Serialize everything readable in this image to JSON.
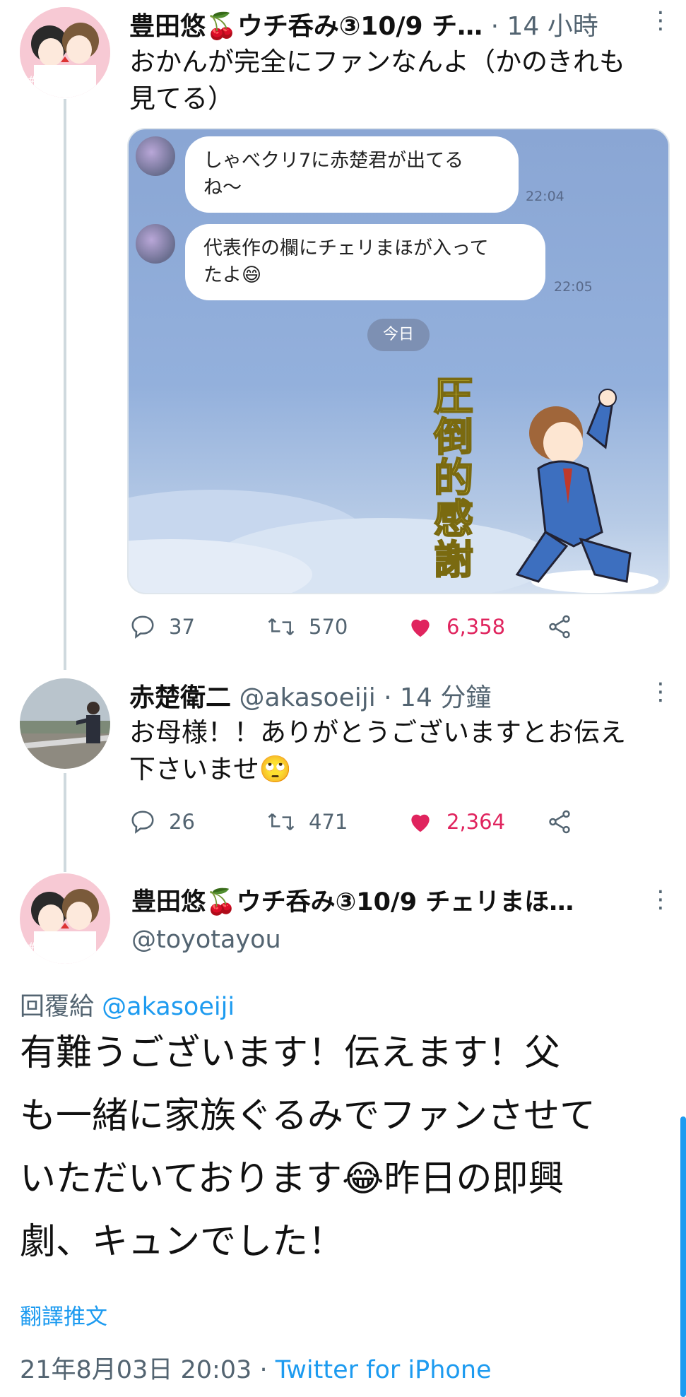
{
  "tweet1": {
    "author": "豊田悠🍒ウチ呑み③10/9 チ…",
    "meta": " · 14 小時",
    "text_line1": "おかんが完全にファンなんよ（かのきれも",
    "text_line2": "見てる）",
    "media": {
      "msg1_line1": "しゃべクリ7に赤楚君が出てる",
      "msg1_line2": "ね〜",
      "msg1_time": "22:04",
      "msg2_line1": "代表作の欄にチェリまほが入って",
      "msg2_line2": "たよ😄",
      "msg2_time": "22:05",
      "date_pill": "今日",
      "sticker_text": "圧倒的感謝"
    },
    "replies": "37",
    "retweets": "570",
    "likes": "6,358"
  },
  "tweet2": {
    "author": "赤楚衛二",
    "meta": " @akasoeiji · 14 分鐘",
    "text_line1": "お母様！！ありがとうございますとお伝え",
    "text_line2": "下さいませ🙄",
    "replies": "26",
    "retweets": "471",
    "likes": "2,364"
  },
  "tweet3": {
    "author": "豊田悠🍒ウチ呑み③10/9 チェリまほ…",
    "handle": "@toyotayou",
    "reply_prefix": "回覆給 ",
    "reply_to": "@akasoeiji",
    "text_line1": "有難うございます！伝えます！父",
    "text_line2": "も一緒に家族ぐるみでファンさせて",
    "text_line3": "いただいております😂昨日の即興",
    "text_line4": "劇、キュンでした！",
    "translate": "翻譯推文",
    "date": "21年8月03日 20:03 · ",
    "source": "Twitter for iPhone"
  },
  "avatar_badge": "#チェリまほ",
  "colors": {
    "accent": "#1d9bf0",
    "like": "#e0245e",
    "chat_bg": "#8aa6d4"
  }
}
